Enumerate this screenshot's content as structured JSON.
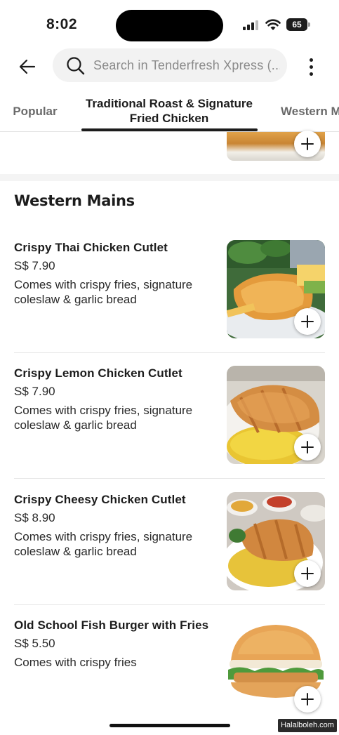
{
  "status_bar": {
    "time": "8:02",
    "battery": "65"
  },
  "search": {
    "placeholder": "Search in Tenderfresh Xpress (..."
  },
  "tabs": [
    {
      "label": "Popular"
    },
    {
      "label": "Traditional Roast & Signature Fried Chicken"
    },
    {
      "label": "Western Mains"
    }
  ],
  "section": {
    "title": "Western Mains"
  },
  "items": [
    {
      "name": "Crispy Thai Chicken Cutlet",
      "price": "S$ 7.90",
      "description": "Comes with crispy fries, signature coleslaw & garlic bread"
    },
    {
      "name": "Crispy Lemon Chicken Cutlet",
      "price": "S$ 7.90",
      "description": "Comes with crispy fries, signature coleslaw & garlic bread"
    },
    {
      "name": "Crispy Cheesy Chicken Cutlet",
      "price": "S$ 8.90",
      "description": "Comes with crispy fries, signature coleslaw & garlic bread"
    },
    {
      "name": "Old School Fish Burger with Fries",
      "price": "S$ 5.50",
      "description": "Comes with crispy fries"
    }
  ],
  "icons": {
    "back": "arrow-left-icon",
    "search": "search-icon",
    "more": "more-vertical-icon",
    "add": "plus-icon"
  },
  "watermark": "Halalboleh.com"
}
